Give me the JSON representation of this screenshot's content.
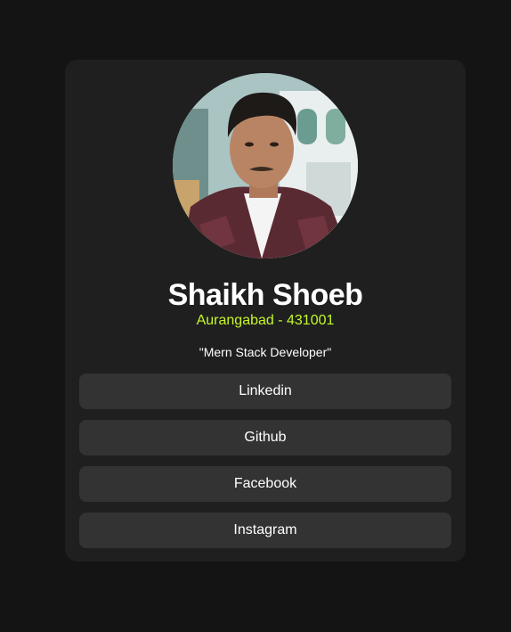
{
  "colors": {
    "page_background": "#141414",
    "card_background": "#1f1f1f",
    "button_background": "#333333",
    "accent": "#c5f82a",
    "text": "#ffffff"
  },
  "profile": {
    "name": "Shaikh Shoeb",
    "location": "Aurangabad - 431001",
    "bio": "\"Mern Stack Developer\""
  },
  "links": [
    {
      "label": "Linkedin"
    },
    {
      "label": "Github"
    },
    {
      "label": "Facebook"
    },
    {
      "label": "Instagram"
    }
  ]
}
